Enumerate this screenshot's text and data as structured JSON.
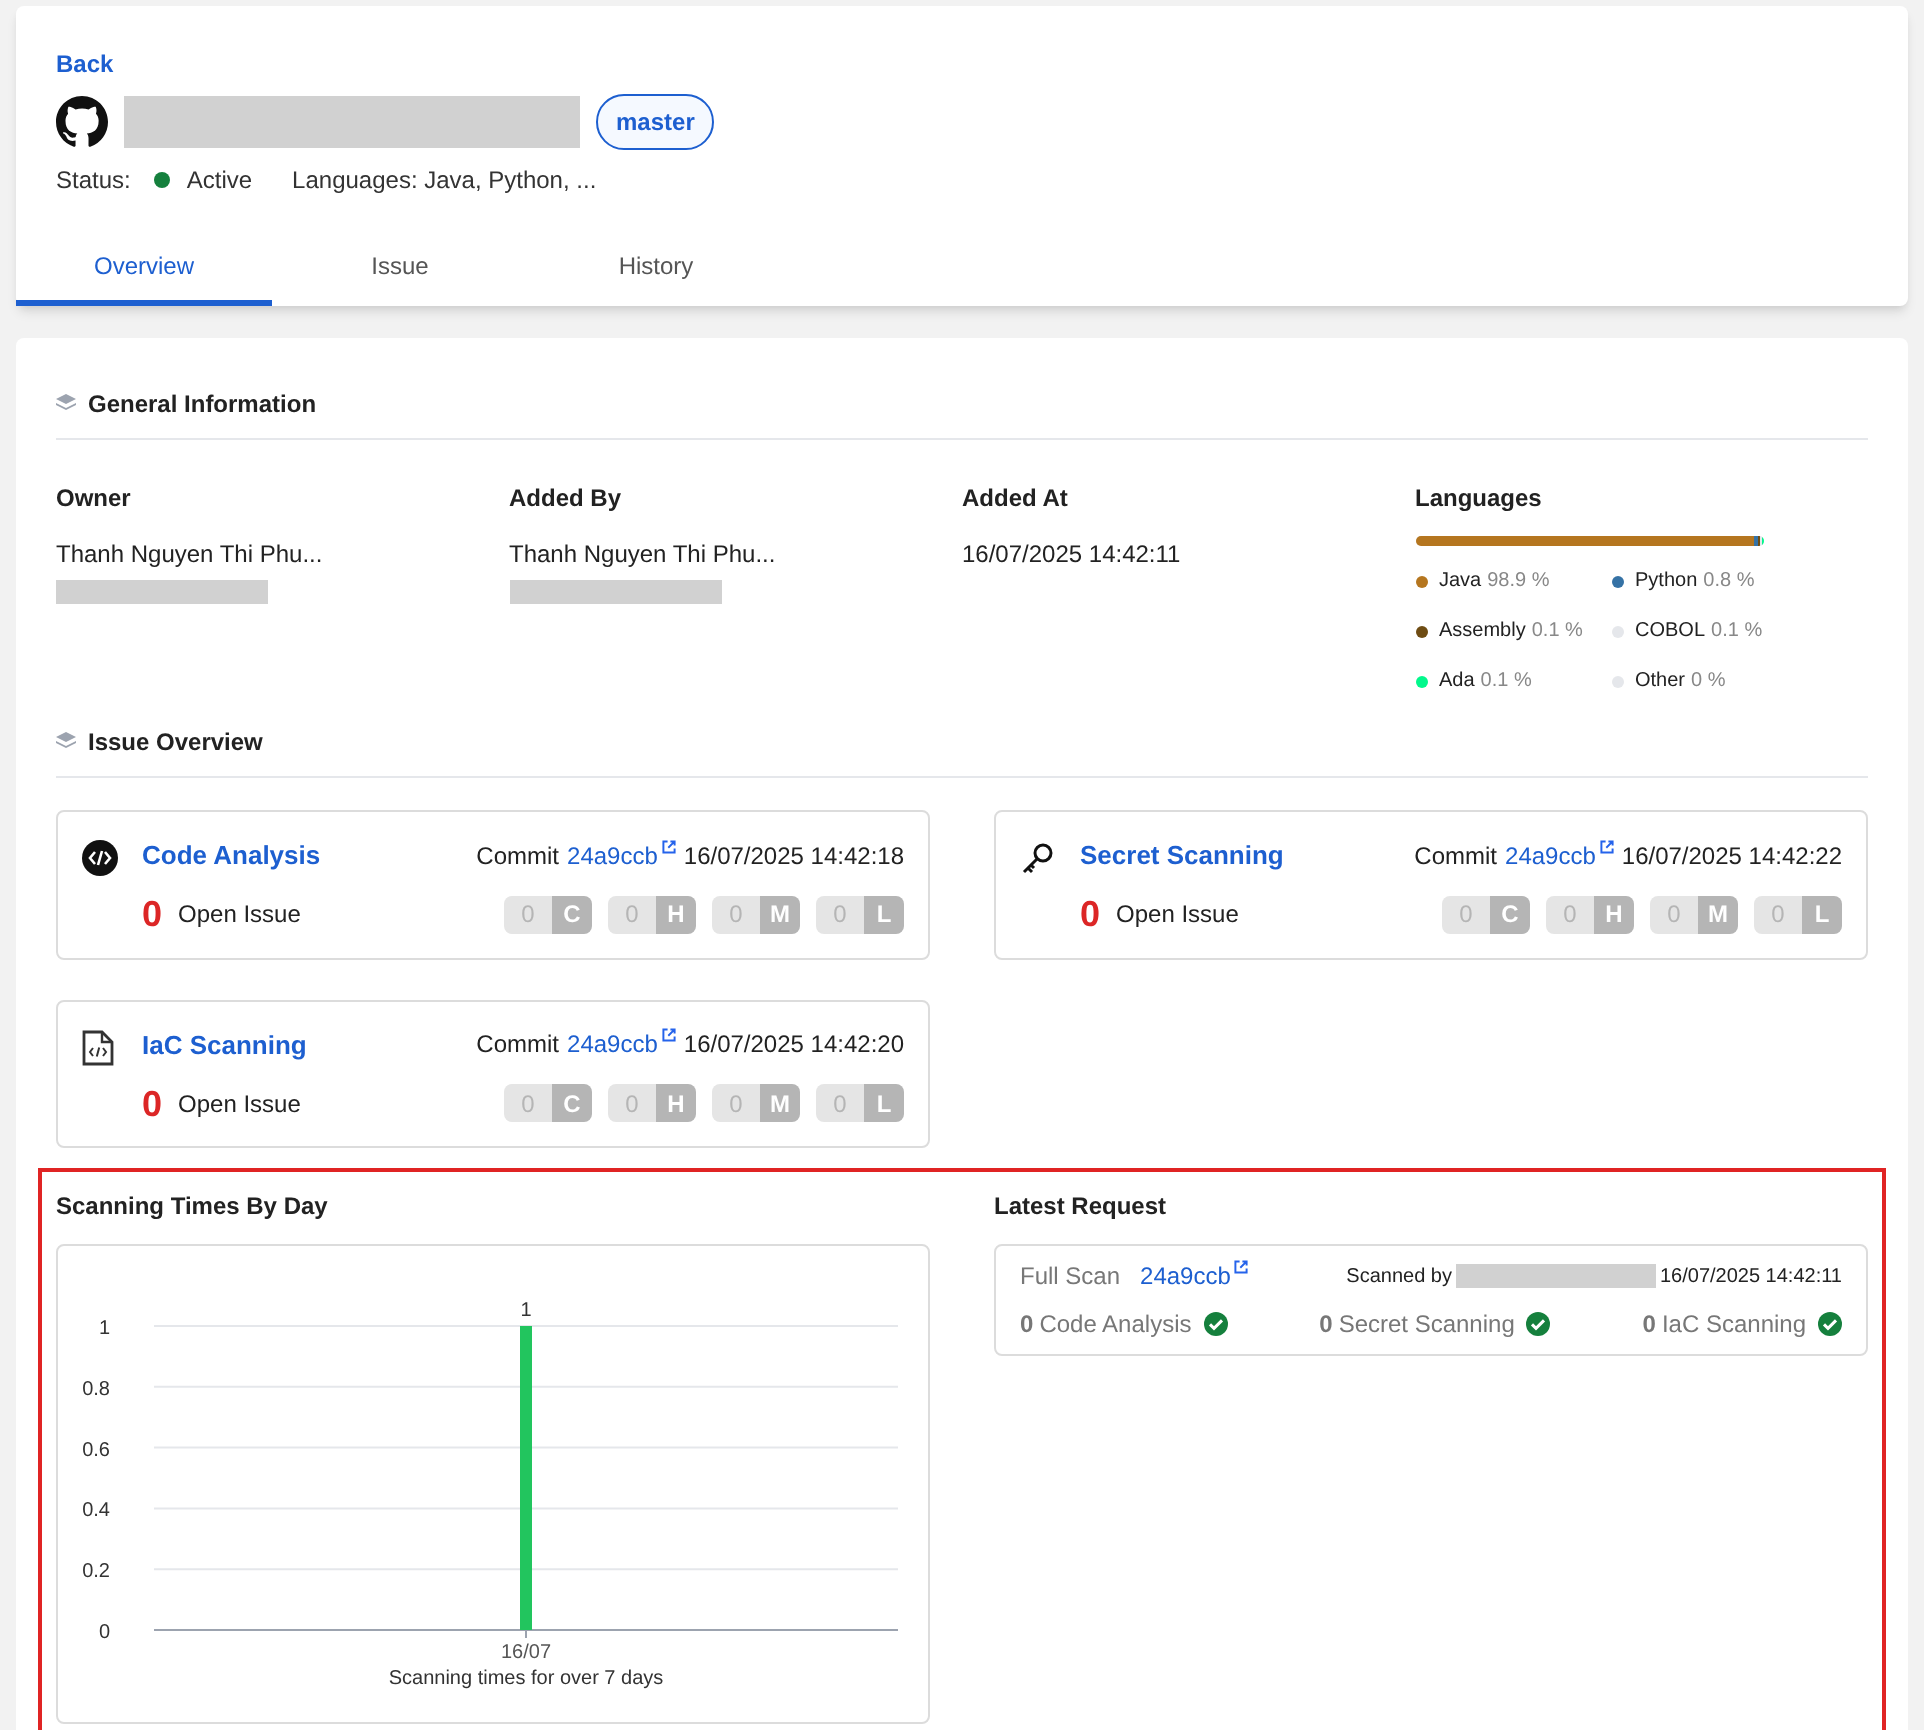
{
  "header": {
    "back": "Back",
    "branch": "master",
    "status_label": "Status:",
    "status": "Active",
    "active": true,
    "languages": "Languages: Java, Python, ..."
  },
  "tabs": [
    {
      "label": "Overview",
      "selected": true
    },
    {
      "label": "Issue",
      "selected": false
    },
    {
      "label": "History",
      "selected": false
    }
  ],
  "general": {
    "title": "General Information",
    "fields": [
      {
        "label": "Owner",
        "value": "Thanh Nguyen Thi Phu..."
      },
      {
        "label": "Added By",
        "value": "Thanh Nguyen Thi Phu..."
      },
      {
        "label": "Added At",
        "value": "16/07/2025 14:42:11"
      }
    ],
    "languages_title": "Languages",
    "languages": [
      {
        "name": "Java",
        "percent": "98.9 %",
        "level": 0.989,
        "color": "#b5761f"
      },
      {
        "name": "Python",
        "percent": "0.8 %",
        "level": 0.008,
        "color": "#3572a5"
      },
      {
        "name": "Assembly",
        "percent": "0.1 %",
        "level": 0.001,
        "color": "#6e4c13"
      },
      {
        "name": "COBOL",
        "percent": "0.1 %",
        "level": 0.001,
        "color": "#e5e7eb"
      },
      {
        "name": "Ada",
        "percent": "0.1 %",
        "level": 0.001,
        "color": "#02f88c"
      },
      {
        "name": "Other",
        "percent": "0 %",
        "level": 0,
        "color": "#e5e7eb"
      }
    ]
  },
  "issue_overview": {
    "title": "Issue Overview",
    "cards": [
      {
        "kind": "code",
        "title": "Code Analysis",
        "commit_label": "Commit",
        "commit": "24a9ccb",
        "time": "16/07/2025 14:42:18",
        "count": "0",
        "count_label": "Open Issue",
        "severities": [
          {
            "count": "0",
            "letter": "C"
          },
          {
            "count": "0",
            "letter": "H"
          },
          {
            "count": "0",
            "letter": "M"
          },
          {
            "count": "0",
            "letter": "L"
          }
        ]
      },
      {
        "kind": "secret",
        "title": "Secret Scanning",
        "commit_label": "Commit",
        "commit": "24a9ccb",
        "time": "16/07/2025 14:42:22",
        "count": "0",
        "count_label": "Open Issue",
        "severities": [
          {
            "count": "0",
            "letter": "C"
          },
          {
            "count": "0",
            "letter": "H"
          },
          {
            "count": "0",
            "letter": "M"
          },
          {
            "count": "0",
            "letter": "L"
          }
        ]
      },
      {
        "kind": "iac",
        "title": "IaC Scanning",
        "commit_label": "Commit",
        "commit": "24a9ccb",
        "time": "16/07/2025 14:42:20",
        "count": "0",
        "count_label": "Open Issue",
        "severities": [
          {
            "count": "0",
            "letter": "C"
          },
          {
            "count": "0",
            "letter": "H"
          },
          {
            "count": "0",
            "letter": "M"
          },
          {
            "count": "0",
            "letter": "L"
          }
        ]
      }
    ]
  },
  "scanning": {
    "title": "Scanning Times By Day",
    "chart_data": {
      "type": "bar",
      "xlabel": "Scanning times for over 7 days",
      "categories": [
        "16/07"
      ],
      "series": [
        {
          "color": "#22c55e",
          "values": [
            1
          ]
        }
      ],
      "ylim": [
        0,
        1
      ],
      "yticks": [
        0,
        0.2,
        0.4,
        0.6,
        0.8,
        1
      ],
      "grid": true,
      "data_labels": true
    }
  },
  "latest": {
    "title": "Latest Request",
    "scan_type": "Full Scan",
    "commit": "24a9ccb",
    "scanned_by": "Scanned by",
    "time": "16/07/2025 14:42:11",
    "results": [
      {
        "count": "0",
        "label": "Code Analysis",
        "passed": true
      },
      {
        "count": "0",
        "label": "Secret Scanning",
        "passed": true
      },
      {
        "count": "0",
        "label": "IaC Scanning",
        "passed": true
      }
    ]
  }
}
